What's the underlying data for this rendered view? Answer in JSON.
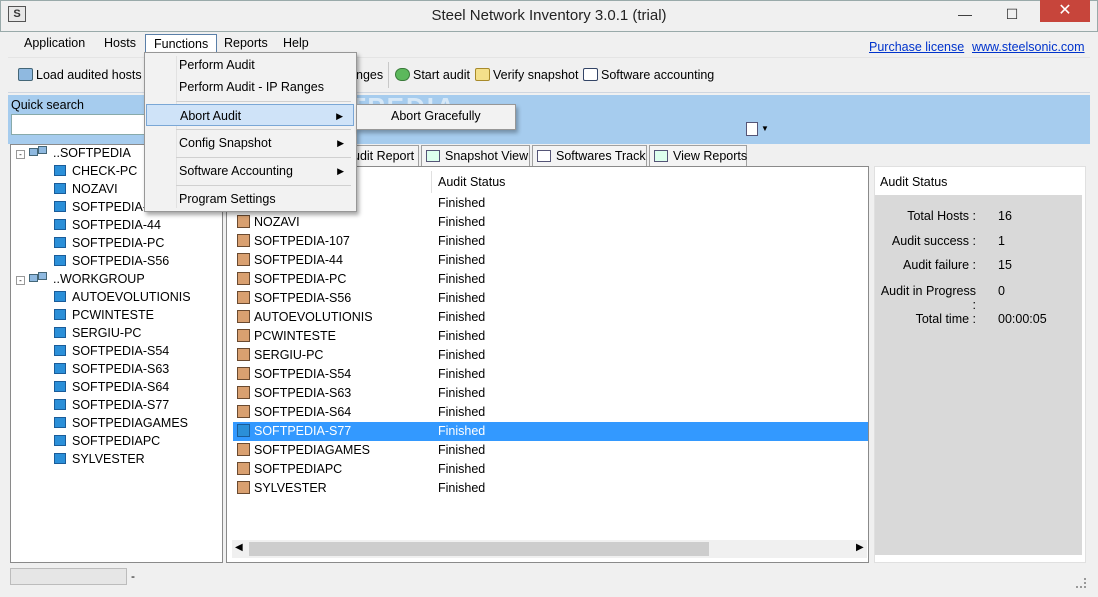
{
  "window": {
    "title": "Steel Network Inventory 3.0.1 (trial)",
    "app_icon": "S",
    "minimize": "—",
    "maximize": "☐",
    "close": "✕"
  },
  "menu": {
    "items": [
      "Application",
      "Hosts",
      "Functions",
      "Reports",
      "Help"
    ],
    "links": [
      "Purchase license",
      "www.steelsonic.com"
    ]
  },
  "toolbar": {
    "load": "Load audited hosts",
    "ranges": "nges",
    "start_audit": "Start audit",
    "verify_snapshot": "Verify snapshot",
    "software_accounting": "Software accounting"
  },
  "functions_menu": {
    "items": [
      "Perform Audit",
      "Perform Audit - IP Ranges",
      "Abort Audit",
      "Config Snapshot",
      "Software Accounting",
      "Program Settings"
    ],
    "submenu_item": "Abort Gracefully"
  },
  "quick_search": {
    "label": "Quick search",
    "value": ""
  },
  "watermark": "SOFTPEDIA",
  "tree": {
    "groups": [
      {
        "name": "..SOFTPEDIA",
        "hosts": [
          "CHECK-PC",
          "NOZAVI",
          "SOFTPEDIA-1",
          "SOFTPEDIA-44",
          "SOFTPEDIA-PC",
          "SOFTPEDIA-S56"
        ]
      },
      {
        "name": "..WORKGROUP",
        "hosts": [
          "AUTOEVOLUTIONIS",
          "PCWINTESTE",
          "SERGIU-PC",
          "SOFTPEDIA-S54",
          "SOFTPEDIA-S63",
          "SOFTPEDIA-S64",
          "SOFTPEDIA-S77",
          "SOFTPEDIAGAMES",
          "SOFTPEDIAPC",
          "SYLVESTER"
        ]
      }
    ]
  },
  "tabs": [
    "udit Report",
    "Snapshot View",
    "Softwares Track",
    "View Reports"
  ],
  "list": {
    "columns": [
      "Audit Status"
    ],
    "rows": [
      {
        "host": "NOZAVI",
        "status": "Finished"
      },
      {
        "host": "SOFTPEDIA-107",
        "status": "Finished"
      },
      {
        "host": "SOFTPEDIA-44",
        "status": "Finished"
      },
      {
        "host": "SOFTPEDIA-PC",
        "status": "Finished"
      },
      {
        "host": "SOFTPEDIA-S56",
        "status": "Finished"
      },
      {
        "host": "AUTOEVOLUTIONIS",
        "status": "Finished"
      },
      {
        "host": "PCWINTESTE",
        "status": "Finished"
      },
      {
        "host": "SERGIU-PC",
        "status": "Finished"
      },
      {
        "host": "SOFTPEDIA-S54",
        "status": "Finished"
      },
      {
        "host": "SOFTPEDIA-S63",
        "status": "Finished"
      },
      {
        "host": "SOFTPEDIA-S64",
        "status": "Finished"
      },
      {
        "host": "SOFTPEDIA-S77",
        "status": "Finished"
      },
      {
        "host": "SOFTPEDIAGAMES",
        "status": "Finished"
      },
      {
        "host": "SOFTPEDIAPC",
        "status": "Finished"
      },
      {
        "host": "SYLVESTER",
        "status": "Finished"
      }
    ],
    "partial_top_status": "Finished",
    "selected_index": 11
  },
  "audit_status": {
    "title": "Audit Status",
    "items": [
      {
        "label": "Total Hosts :",
        "value": "16"
      },
      {
        "label": "Audit success :",
        "value": "1"
      },
      {
        "label": "Audit failure :",
        "value": "15"
      },
      {
        "label": "Audit in Progress :",
        "value": "0"
      },
      {
        "label": "Total time :",
        "value": "00:00:05"
      }
    ]
  },
  "statusbar": {
    "text": "-"
  }
}
